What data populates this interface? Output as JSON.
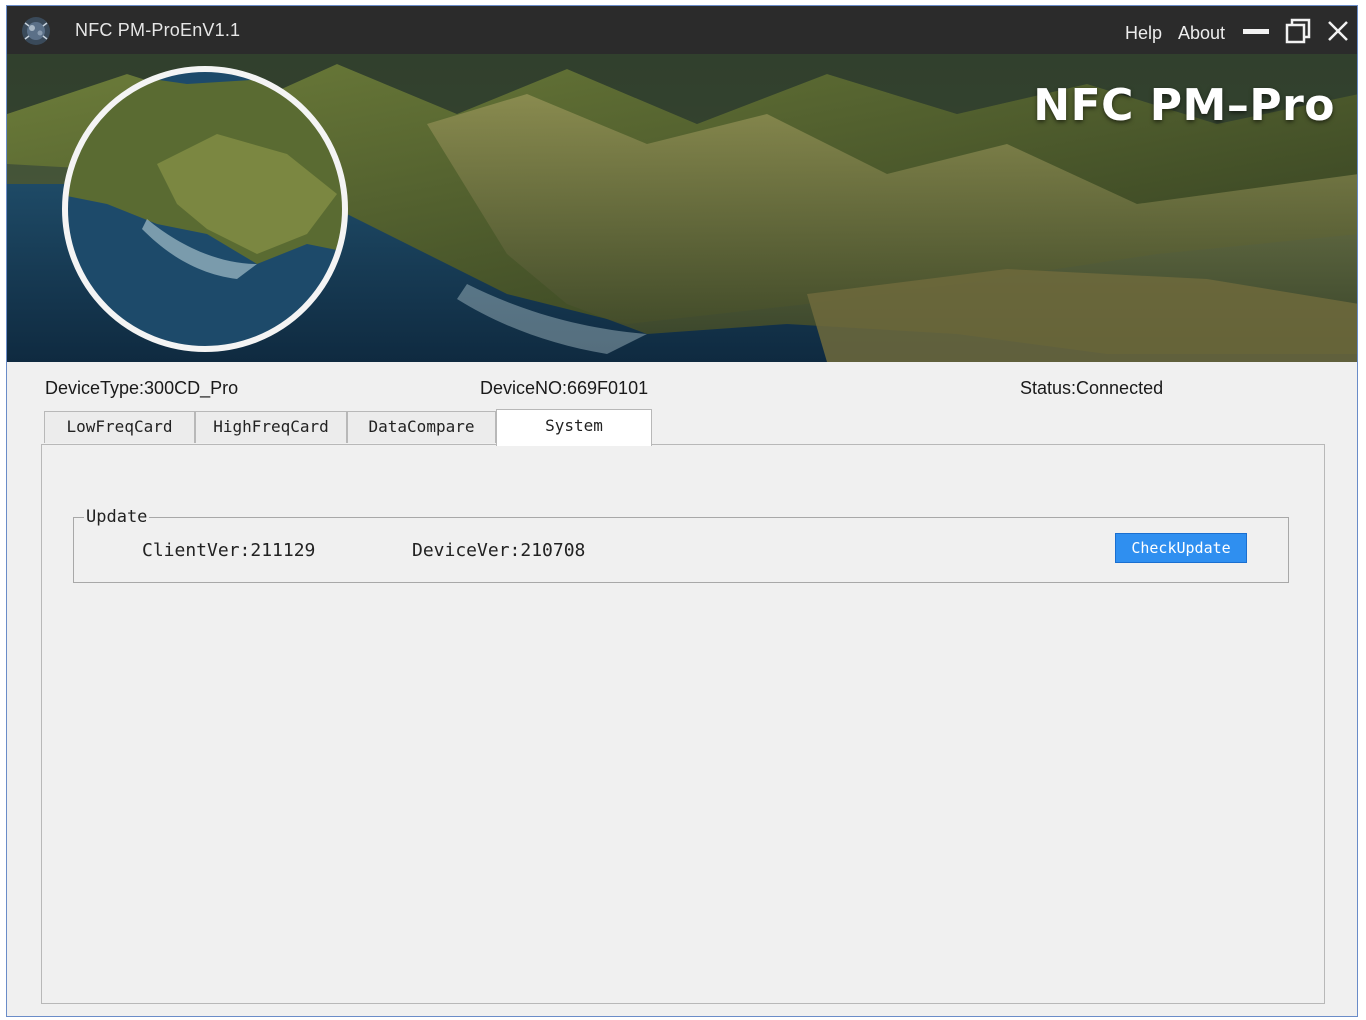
{
  "window": {
    "title": "NFC PM-ProEnV1.1",
    "menu": {
      "help": "Help",
      "about": "About"
    }
  },
  "banner": {
    "title": "NFC PM–Pro"
  },
  "device": {
    "type": "DeviceType:300CD_Pro",
    "number": "DeviceNO:669F0101",
    "status": "Status:Connected"
  },
  "tabs": [
    {
      "label": "LowFreqCard",
      "active": false
    },
    {
      "label": "HighFreqCard",
      "active": false
    },
    {
      "label": "DataCompare",
      "active": false
    },
    {
      "label": "System",
      "active": true
    }
  ],
  "system": {
    "update": {
      "legend": "Update",
      "client_ver": "ClientVer:211129",
      "device_ver": "DeviceVer:210708",
      "check_button": "CheckUpdate"
    }
  },
  "icons": {
    "app": "app-logo-icon",
    "minimize": "minimize-icon",
    "maximize": "maximize-icon",
    "close": "close-icon"
  },
  "colors": {
    "titlebar": "#2b2b2b",
    "accent_button": "#2f8ff0",
    "window_bg": "#f0f0f0"
  }
}
